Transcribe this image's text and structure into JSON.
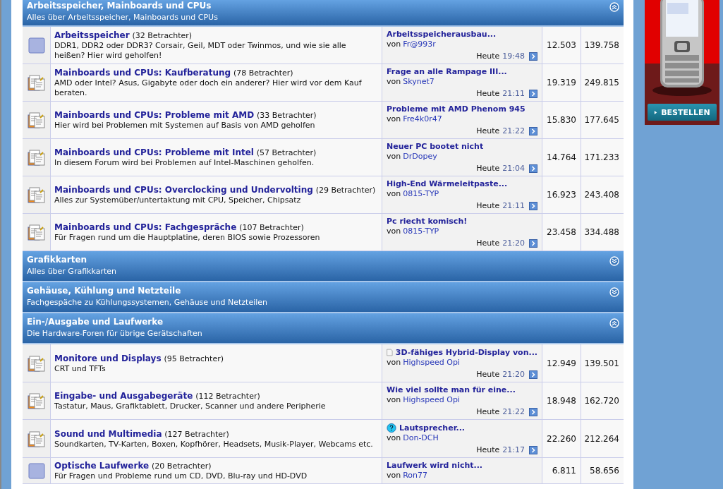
{
  "sections": [
    {
      "title": "Arbeitsspeicher, Mainboards und CPUs",
      "description": "Alles über Arbeitsspeicher, Mainboards und CPUs",
      "expanded": true,
      "forums": [
        {
          "kind": "old",
          "title": "Arbeitsspeicher",
          "viewers": "(32 Betrachter)",
          "description": "DDR1, DDR2 oder DDR3? Corsair, Geil, MDT oder Twinmos, und wie sie alle heißen? Hier wird geholfen!",
          "last_post": {
            "title": "Arbeitsspeicherausbau...",
            "by": "von",
            "author": "Fr@993r",
            "day": "Heute",
            "time": "19:48"
          },
          "threads": "12.503",
          "posts": "139.758"
        },
        {
          "kind": "new",
          "title": "Mainboards und CPUs: Kaufberatung",
          "viewers": "(78 Betrachter)",
          "description": "AMD oder Intel? Asus, Gigabyte oder doch ein anderer? Hier wird vor dem Kauf beraten.",
          "last_post": {
            "title": "Frage an alle Rampage III...",
            "by": "von",
            "author": "Skynet7",
            "day": "Heute",
            "time": "21:11"
          },
          "threads": "19.319",
          "posts": "249.815"
        },
        {
          "kind": "new",
          "title": "Mainboards und CPUs: Probleme mit AMD",
          "viewers": "(33 Betrachter)",
          "description": "Hier wird bei Problemen mit Systemen auf Basis von AMD geholfen",
          "last_post": {
            "title": "Probleme mit AMD Phenom 945",
            "by": "von",
            "author": "Fre4k0r47",
            "day": "Heute",
            "time": "21:22"
          },
          "threads": "15.830",
          "posts": "177.645"
        },
        {
          "kind": "new",
          "title": "Mainboards und CPUs: Probleme mit Intel",
          "viewers": "(57 Betrachter)",
          "description": "In diesem Forum wird bei Problemen auf Intel-Maschinen geholfen.",
          "last_post": {
            "title": "Neuer PC bootet nicht",
            "by": "von",
            "author": "DrDopey",
            "day": "Heute",
            "time": "21:04"
          },
          "threads": "14.764",
          "posts": "171.233"
        },
        {
          "kind": "new",
          "title": "Mainboards und CPUs: Overclocking und Undervolting",
          "viewers": "(29 Betrachter)",
          "description": "Alles zur Systemüber/untertaktung mit CPU, Speicher, Chipsatz",
          "last_post": {
            "title": "High-End Wärmeleitpaste...",
            "by": "von",
            "author": "0815-TYP",
            "day": "Heute",
            "time": "21:11"
          },
          "threads": "16.923",
          "posts": "243.408"
        },
        {
          "kind": "new",
          "title": "Mainboards und CPUs: Fachgespräche",
          "viewers": "(107 Betrachter)",
          "description": "Für Fragen rund um die Hauptplatine, deren BIOS sowie Prozessoren",
          "last_post": {
            "title": "Pc riecht komisch!",
            "by": "von",
            "author": "0815-TYP",
            "day": "Heute",
            "time": "21:20"
          },
          "threads": "23.458",
          "posts": "334.488"
        }
      ]
    },
    {
      "title": "Grafikkarten",
      "description": "Alles über Grafikkarten",
      "expanded": false
    },
    {
      "title": "Gehäuse, Kühlung und Netzteile",
      "description": "Fachgespäche zu Kühlungssystemen, Gehäuse und Netzteilen",
      "expanded": false
    },
    {
      "title": "Ein-/Ausgabe und Laufwerke",
      "description": "Die Hardware-Foren für übrige Gerätschaften",
      "expanded": true,
      "forums": [
        {
          "kind": "new",
          "title": "Monitore und Displays",
          "viewers": "(95 Betrachter)",
          "description": "CRT und TFTs",
          "last_post": {
            "kind": "document",
            "title": "3D-fähiges Hybrid-Display von...",
            "by": "von",
            "author": "Highspeed Opi",
            "day": "Heute",
            "time": "21:20"
          },
          "threads": "12.949",
          "posts": "139.501"
        },
        {
          "kind": "new",
          "title": "Eingabe- und Ausgabegeräte",
          "viewers": "(112 Betrachter)",
          "description": "Tastatur, Maus, Grafiktablett, Drucker, Scanner und andere Peripherie",
          "last_post": {
            "title": "Wie viel sollte man für eine...",
            "by": "von",
            "author": "Highspeed Opi",
            "day": "Heute",
            "time": "21:22"
          },
          "threads": "18.948",
          "posts": "162.720"
        },
        {
          "kind": "new",
          "title": "Sound und Multimedia",
          "viewers": "(127 Betrachter)",
          "description": "Soundkarten, TV-Karten, Boxen, Kopfhörer, Headsets, Musik-Player, Webcams etc.",
          "last_post": {
            "kind": "question",
            "title": "Lautsprecher...",
            "by": "von",
            "author": "Don-DCH",
            "day": "Heute",
            "time": "21:17"
          },
          "threads": "22.260",
          "posts": "212.264"
        },
        {
          "kind": "old",
          "title": "Optische Laufwerke",
          "viewers": "(20 Betrachter)",
          "description": "Für Fragen und Probleme rund um CD, DVD, Blu-ray und HD-DVD",
          "last_post": {
            "title": "Laufwerk wird nicht...",
            "by": "von",
            "author": "Ron77"
          },
          "threads": "6.811",
          "posts": "58.656"
        }
      ]
    }
  ],
  "ad": {
    "kind": "picture",
    "button": "BESTELLEN"
  }
}
